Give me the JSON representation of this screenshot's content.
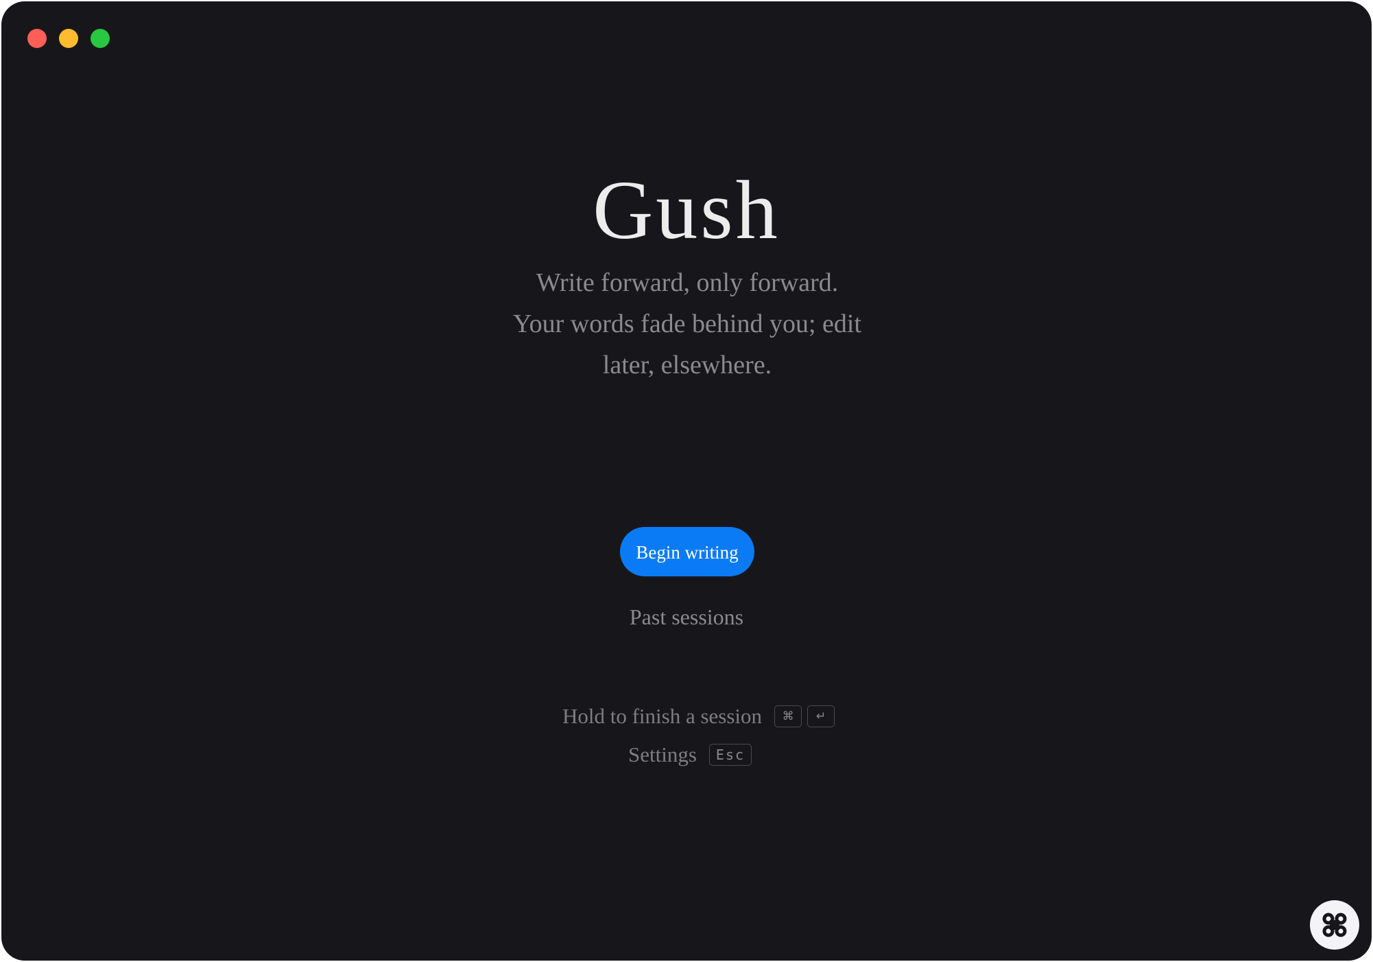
{
  "window": {
    "controls": [
      "close",
      "minimize",
      "zoom"
    ]
  },
  "hero": {
    "title": "Gush",
    "tagline": "Write forward, only forward. Your words fade behind you; edit later, elsewhere."
  },
  "actions": {
    "begin_label": "Begin writing",
    "past_label": "Past sessions"
  },
  "hints": {
    "finish": {
      "label": "Hold to finish a session",
      "keys": [
        "⌘",
        "↵"
      ]
    },
    "settings": {
      "label": "Settings",
      "key": "Esc"
    }
  },
  "floating_button": {
    "icon": "command-icon"
  },
  "colors": {
    "background": "#17171b",
    "accent": "#0a7bf5",
    "title": "#ececec",
    "muted": "#8a8a90"
  }
}
